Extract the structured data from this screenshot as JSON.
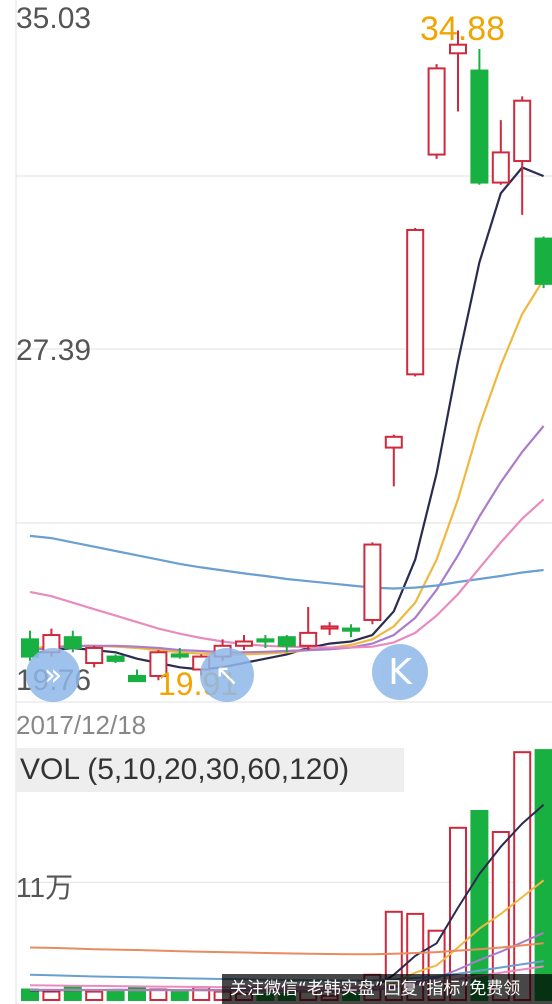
{
  "chart_data": {
    "type": "candlestick",
    "price_axis": {
      "labels": [
        "35.03",
        "27.39",
        "19.76"
      ],
      "range": [
        19.76,
        35.03
      ],
      "annotated_high": "34.88",
      "annotated_low": "19.91",
      "grid": true
    },
    "date_label": "2017/12/18",
    "candles": [
      {
        "o": 20.35,
        "c": 20.75,
        "h": 20.95,
        "l": 20.25,
        "up": false
      },
      {
        "o": 20.45,
        "c": 20.85,
        "h": 21.0,
        "l": 20.35,
        "up": true
      },
      {
        "o": 20.8,
        "c": 20.55,
        "h": 20.95,
        "l": 20.45,
        "up": false
      },
      {
        "o": 20.2,
        "c": 20.55,
        "h": 20.6,
        "l": 20.1,
        "up": true
      },
      {
        "o": 20.35,
        "c": 20.25,
        "h": 20.4,
        "l": 20.2,
        "up": false
      },
      {
        "o": 19.9,
        "c": 19.78,
        "h": 20.05,
        "l": 19.76,
        "up": false
      },
      {
        "o": 19.9,
        "c": 20.45,
        "h": 20.5,
        "l": 19.8,
        "up": true
      },
      {
        "o": 20.4,
        "c": 20.35,
        "h": 20.55,
        "l": 20.3,
        "up": false
      },
      {
        "o": 20.05,
        "c": 20.35,
        "h": 20.4,
        "l": 19.91,
        "up": true
      },
      {
        "o": 20.35,
        "c": 20.6,
        "h": 20.75,
        "l": 20.25,
        "up": true
      },
      {
        "o": 20.6,
        "c": 20.7,
        "h": 20.85,
        "l": 20.5,
        "up": true
      },
      {
        "o": 20.75,
        "c": 20.7,
        "h": 20.85,
        "l": 20.55,
        "up": false
      },
      {
        "o": 20.8,
        "c": 20.6,
        "h": 20.85,
        "l": 20.45,
        "up": false
      },
      {
        "o": 20.6,
        "c": 20.9,
        "h": 21.5,
        "l": 20.5,
        "up": true
      },
      {
        "o": 21.0,
        "c": 21.05,
        "h": 21.15,
        "l": 20.85,
        "up": true
      },
      {
        "o": 21.0,
        "c": 20.95,
        "h": 21.1,
        "l": 20.8,
        "up": false
      },
      {
        "o": 21.2,
        "c": 22.95,
        "h": 23.0,
        "l": 21.1,
        "up": true
      },
      {
        "o": 25.2,
        "c": 25.45,
        "h": 25.5,
        "l": 24.3,
        "up": true
      },
      {
        "o": 26.9,
        "c": 30.25,
        "h": 30.3,
        "l": 26.85,
        "up": true
      },
      {
        "o": 32.0,
        "c": 34.0,
        "h": 34.1,
        "l": 31.9,
        "up": true
      },
      {
        "o": 34.55,
        "c": 34.35,
        "h": 34.88,
        "l": 33.0,
        "up": true
      },
      {
        "o": 33.95,
        "c": 31.35,
        "h": 34.45,
        "l": 31.3,
        "up": false
      },
      {
        "o": 32.05,
        "c": 31.35,
        "h": 32.8,
        "l": 31.3,
        "up": true
      },
      {
        "o": 31.85,
        "c": 33.25,
        "h": 33.35,
        "l": 30.6,
        "up": true
      },
      {
        "o": 30.05,
        "c": 29.0,
        "h": 30.1,
        "l": 28.9,
        "up": false
      }
    ],
    "moving_averages": [
      {
        "color": "#2b2b50",
        "values": [
          20.4,
          20.5,
          20.55,
          20.5,
          20.45,
          20.3,
          20.2,
          20.1,
          20.05,
          20.1,
          20.2,
          20.3,
          20.4,
          20.55,
          20.65,
          20.7,
          20.85,
          21.4,
          22.6,
          24.6,
          27.2,
          29.5,
          31.1,
          31.7,
          31.5
        ]
      },
      {
        "color": "#f0b840",
        "values": [
          20.55,
          20.58,
          20.6,
          20.6,
          20.58,
          20.55,
          20.5,
          20.45,
          20.42,
          20.4,
          20.4,
          20.42,
          20.45,
          20.5,
          20.55,
          20.62,
          20.75,
          21.05,
          21.6,
          22.6,
          24.0,
          25.7,
          27.1,
          28.3,
          29.1
        ]
      },
      {
        "color": "#a97ccc",
        "values": [
          20.5,
          20.55,
          20.6,
          20.6,
          20.6,
          20.58,
          20.55,
          20.5,
          20.48,
          20.45,
          20.45,
          20.46,
          20.48,
          20.5,
          20.52,
          20.56,
          20.65,
          20.85,
          21.25,
          21.9,
          22.7,
          23.6,
          24.4,
          25.1,
          25.7
        ]
      },
      {
        "color": "#6a9fd0",
        "values": [
          23.15,
          23.1,
          23.0,
          22.9,
          22.8,
          22.7,
          22.6,
          22.5,
          22.42,
          22.35,
          22.28,
          22.22,
          22.15,
          22.1,
          22.05,
          22.0,
          21.95,
          21.93,
          21.95,
          22.0,
          22.08,
          22.15,
          22.22,
          22.3,
          22.36
        ]
      },
      {
        "color": "#e88cc0",
        "values": [
          21.85,
          21.75,
          21.6,
          21.45,
          21.3,
          21.15,
          21.0,
          20.88,
          20.78,
          20.7,
          20.64,
          20.6,
          20.58,
          20.57,
          20.56,
          20.56,
          20.58,
          20.68,
          20.9,
          21.3,
          21.8,
          22.4,
          23.0,
          23.55,
          24.0
        ]
      }
    ],
    "volume": {
      "title": "VOL (5,10,20,30,60,120)",
      "axis_label": "11万",
      "bars": [
        {
          "v": 0.5,
          "up": false
        },
        {
          "v": 0.4,
          "up": true
        },
        {
          "v": 0.6,
          "up": false
        },
        {
          "v": 0.4,
          "up": true
        },
        {
          "v": 0.4,
          "up": false
        },
        {
          "v": 0.6,
          "up": false
        },
        {
          "v": 0.5,
          "up": true
        },
        {
          "v": 0.4,
          "up": false
        },
        {
          "v": 0.6,
          "up": true
        },
        {
          "v": 0.4,
          "up": true
        },
        {
          "v": 0.3,
          "up": true
        },
        {
          "v": 0.3,
          "up": false
        },
        {
          "v": 0.3,
          "up": false
        },
        {
          "v": 0.4,
          "up": true
        },
        {
          "v": 0.2,
          "up": true
        },
        {
          "v": 0.3,
          "up": false
        },
        {
          "v": 1.2,
          "up": true
        },
        {
          "v": 4.2,
          "up": true
        },
        {
          "v": 4.1,
          "up": true
        },
        {
          "v": 3.3,
          "up": true
        },
        {
          "v": 8.2,
          "up": true
        },
        {
          "v": 9.0,
          "up": false
        },
        {
          "v": 8.0,
          "up": true
        },
        {
          "v": 11.8,
          "up": true
        },
        {
          "v": 11.9,
          "up": false
        }
      ],
      "range": [
        0,
        12
      ],
      "label_value": 5.6,
      "mas": [
        {
          "color": "#2b2b50",
          "values": [
            0.45,
            0.46,
            0.47,
            0.47,
            0.48,
            0.48,
            0.48,
            0.47,
            0.47,
            0.46,
            0.45,
            0.44,
            0.43,
            0.42,
            0.4,
            0.38,
            0.55,
            1.2,
            2.1,
            2.7,
            4.4,
            6.0,
            7.3,
            8.4,
            9.3
          ]
        },
        {
          "color": "#f0b840",
          "values": [
            0.48,
            0.48,
            0.48,
            0.47,
            0.47,
            0.47,
            0.46,
            0.46,
            0.46,
            0.45,
            0.45,
            0.44,
            0.43,
            0.42,
            0.42,
            0.41,
            0.46,
            0.8,
            1.3,
            1.65,
            2.5,
            3.4,
            4.1,
            4.9,
            5.7
          ]
        },
        {
          "color": "#a97ccc",
          "values": [
            0.48,
            0.48,
            0.48,
            0.48,
            0.48,
            0.47,
            0.47,
            0.47,
            0.47,
            0.46,
            0.46,
            0.46,
            0.45,
            0.45,
            0.45,
            0.44,
            0.46,
            0.6,
            0.85,
            1.05,
            1.45,
            1.9,
            2.3,
            2.75,
            3.2
          ]
        },
        {
          "color": "#6a9fd0",
          "values": [
            1.2,
            1.18,
            1.15,
            1.12,
            1.1,
            1.08,
            1.06,
            1.04,
            1.02,
            1.0,
            0.98,
            0.96,
            0.95,
            0.94,
            0.93,
            0.92,
            0.93,
            0.98,
            1.05,
            1.12,
            1.25,
            1.4,
            1.55,
            1.7,
            1.85
          ]
        },
        {
          "color": "#e88c60",
          "values": [
            2.5,
            2.48,
            2.45,
            2.42,
            2.4,
            2.38,
            2.35,
            2.32,
            2.3,
            2.28,
            2.26,
            2.24,
            2.22,
            2.2,
            2.19,
            2.18,
            2.18,
            2.2,
            2.24,
            2.28,
            2.35,
            2.42,
            2.5,
            2.6,
            2.7
          ]
        },
        {
          "color": "#e88cc0",
          "values": [
            0.7,
            0.69,
            0.68,
            0.67,
            0.66,
            0.65,
            0.64,
            0.63,
            0.62,
            0.61,
            0.6,
            0.6,
            0.59,
            0.59,
            0.58,
            0.58,
            0.6,
            0.66,
            0.75,
            0.84,
            0.98,
            1.15,
            1.3,
            1.45,
            1.6
          ]
        }
      ]
    },
    "colors": {
      "up": "#d0283c",
      "down": "#18b040",
      "grid": "#e2e2e2"
    }
  },
  "buttons": {
    "expand": "»",
    "back": "↖",
    "k": "K"
  },
  "watermark": "关注微信“老韩实盘”回复“指标”免费领"
}
